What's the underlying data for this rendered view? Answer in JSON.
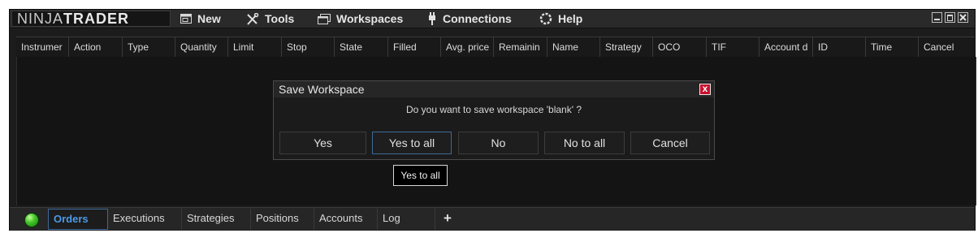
{
  "logo": {
    "prefix": "NINJA",
    "suffix": "TRADER"
  },
  "menu": {
    "items": [
      {
        "label": "New",
        "icon": "new-window-icon"
      },
      {
        "label": "Tools",
        "icon": "tools-icon"
      },
      {
        "label": "Workspaces",
        "icon": "workspaces-icon"
      },
      {
        "label": "Connections",
        "icon": "connections-icon"
      },
      {
        "label": "Help",
        "icon": "help-icon"
      }
    ]
  },
  "window_controls": [
    "minimize-icon",
    "maximize-icon",
    "close-icon"
  ],
  "grid": {
    "columns": [
      "Instrumer",
      "Action",
      "Type",
      "Quantity",
      "Limit",
      "Stop",
      "State",
      "Filled",
      "Avg. price",
      "Remainin",
      "Name",
      "Strategy",
      "OCO",
      "TIF",
      "Account d",
      "ID",
      "Time",
      "Cancel"
    ]
  },
  "dialog": {
    "title": "Save Workspace",
    "message": "Do you want to save workspace 'blank' ?",
    "buttons": [
      "Yes",
      "Yes to all",
      "No",
      "No to all",
      "Cancel"
    ],
    "focused_button": "Yes to all",
    "close_glyph": "x"
  },
  "tooltip": "Yes to all",
  "tabs": {
    "items": [
      "Orders",
      "Executions",
      "Strategies",
      "Positions",
      "Accounts",
      "Log"
    ],
    "active": "Orders",
    "add_label": "+"
  },
  "colors": {
    "accent": "#4a9be8",
    "status_connected": "#47c72b",
    "close_red": "#c8102e"
  }
}
